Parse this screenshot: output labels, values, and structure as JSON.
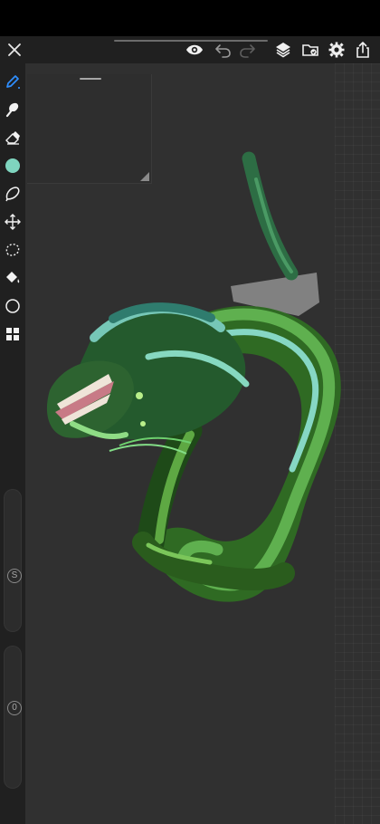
{
  "app": {
    "accent": "#2f8fff",
    "panel_bg": "#202020",
    "canvas_bg": "#303030",
    "current_color": "#7fd5bf"
  },
  "topbar": {
    "close_icon": "close-icon",
    "visibility_icon": "eye-icon",
    "undo_icon": "undo-icon",
    "redo_icon": "redo-icon",
    "layers_icon": "layers-icon",
    "folder_icon": "folder-icon",
    "settings_icon": "gear-icon",
    "share_icon": "share-icon"
  },
  "sidebar": {
    "tools": [
      {
        "icon": "pen-icon",
        "selected": true
      },
      {
        "icon": "brush-icon"
      },
      {
        "icon": "eraser-icon"
      },
      {
        "icon": "color-swatch"
      },
      {
        "icon": "lasso-icon"
      },
      {
        "icon": "transform-icon"
      },
      {
        "icon": "selection-icon"
      },
      {
        "icon": "fill-bucket-icon"
      },
      {
        "icon": "ellipse-icon"
      },
      {
        "icon": "grid-icon"
      }
    ],
    "size_slider_label": "S",
    "opacity_slider_label": "0"
  }
}
